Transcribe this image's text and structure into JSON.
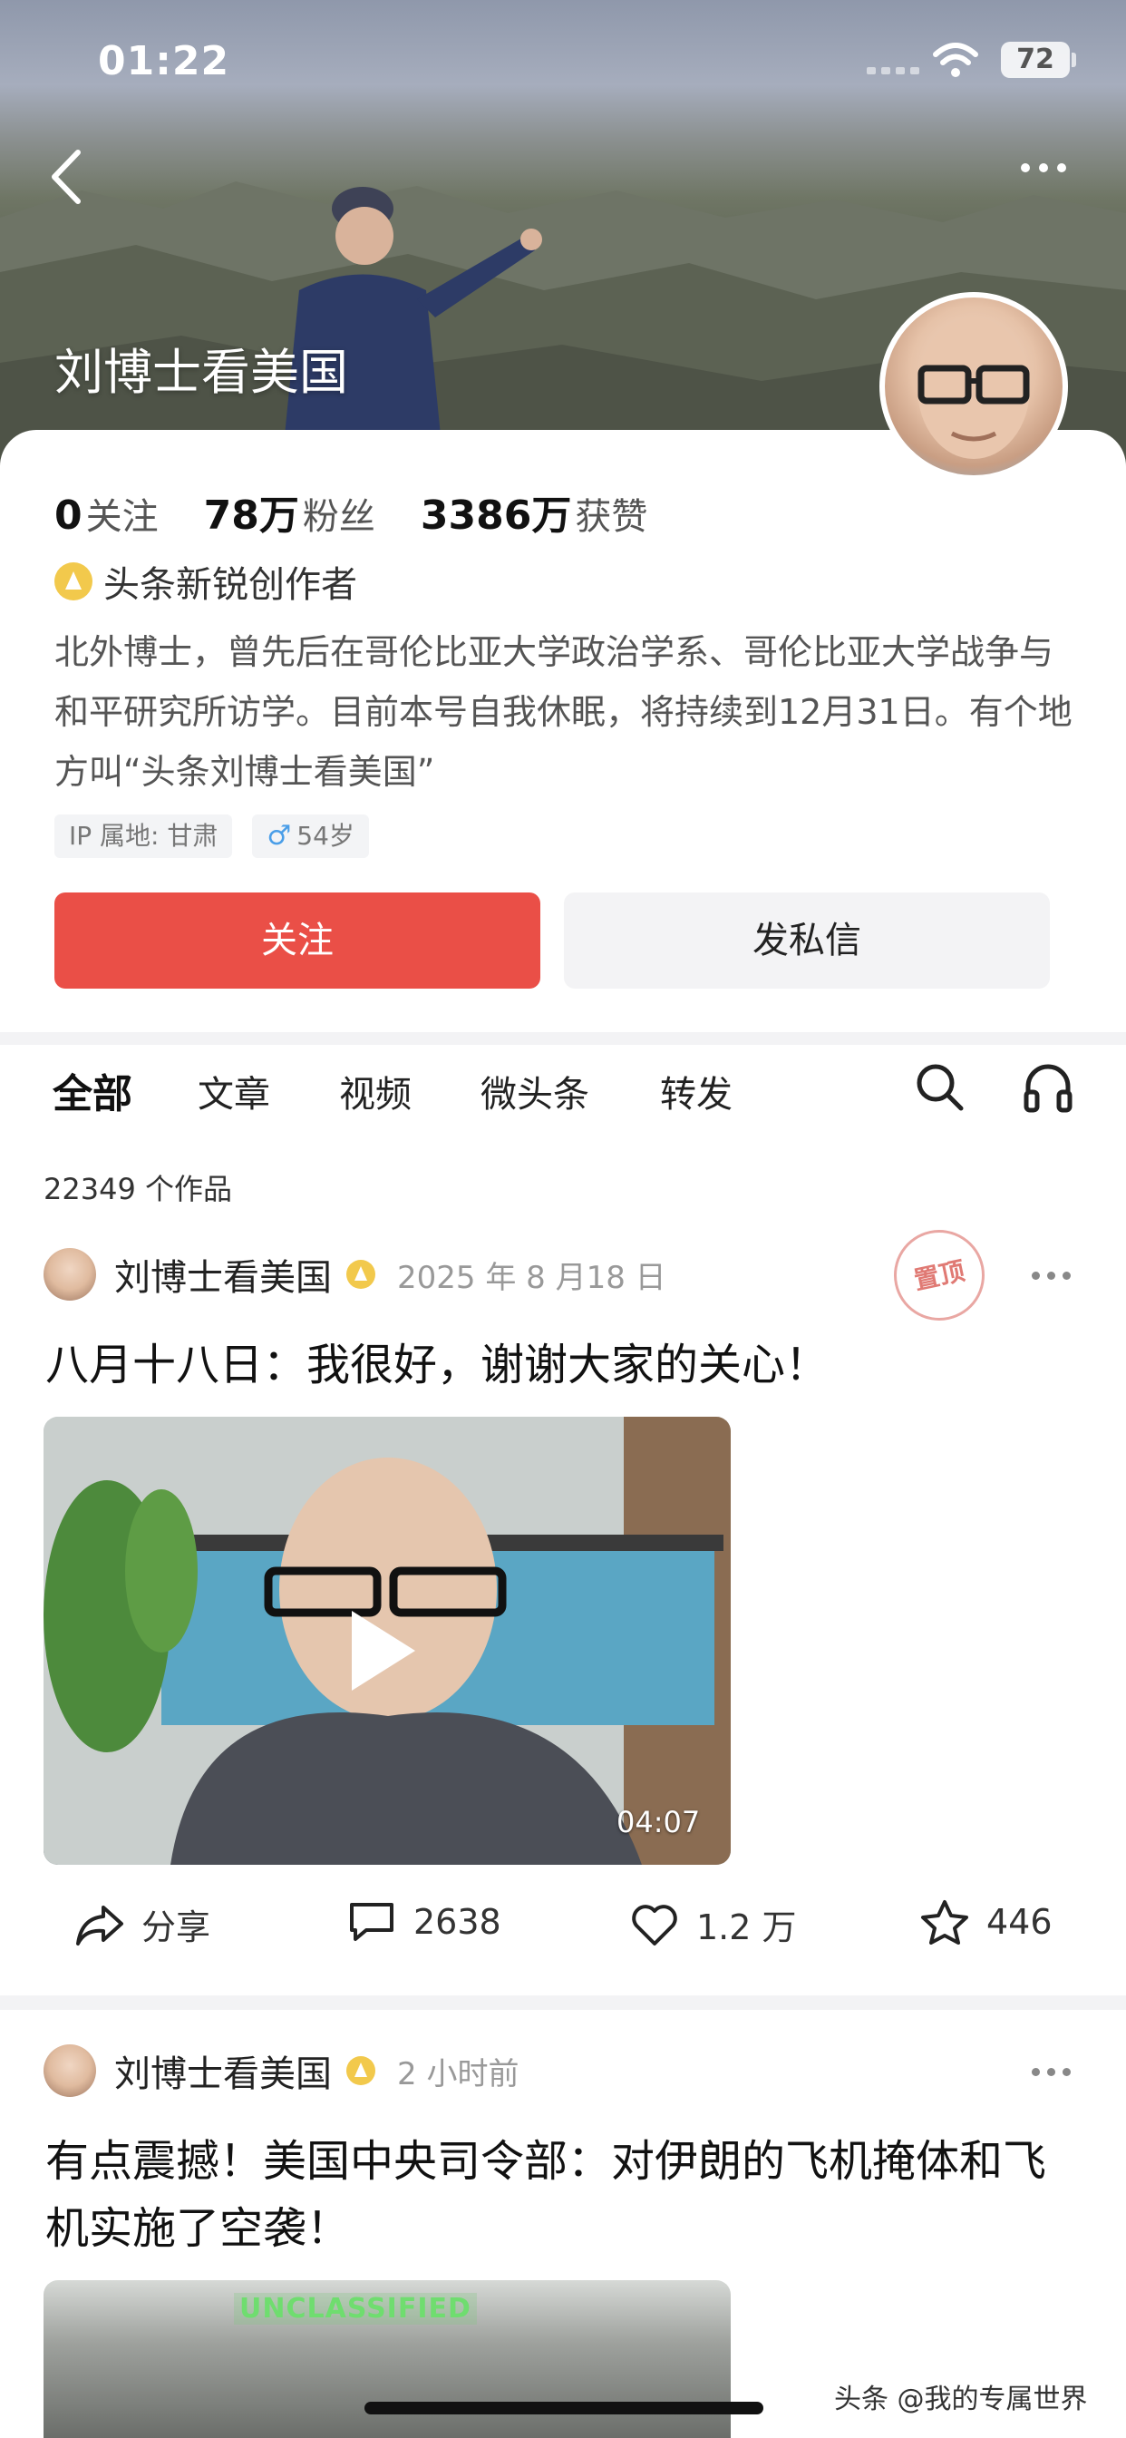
{
  "status_bar": {
    "time": "01:22",
    "battery": "72"
  },
  "profile": {
    "name": "刘博士看美国",
    "stats": [
      {
        "num": "0",
        "label": "关注"
      },
      {
        "num": "78万",
        "label": "粉丝"
      },
      {
        "num": "3386万",
        "label": "获赞"
      }
    ],
    "badge": "头条新锐创作者",
    "bio": "北外博士，曾先后在哥伦比亚大学政治学系、哥伦比亚大学战争与和平研究所访学。目前本号自我休眠，将持续到12月31日。有个地方叫“头条刘博士看美国”",
    "ip_tag": "IP 属地: 甘肃",
    "age_tag": "54岁",
    "follow_label": "关注",
    "message_label": "发私信"
  },
  "tabs": [
    "全部",
    "文章",
    "视频",
    "微头条",
    "转发"
  ],
  "works_count": "22349 个作品",
  "posts": [
    {
      "author": "刘博士看美国",
      "date": "2025 年 8 月18 日",
      "pinned_label": "置顶",
      "title": "八月十八日：我很好，谢谢大家的关心！",
      "duration": "04:07",
      "share_label": "分享",
      "comments": "2638",
      "likes": "1.2 万",
      "favorites": "446"
    },
    {
      "author": "刘博士看美国",
      "date": "2 小时前",
      "title": "有点震撼！美国中央司令部：对伊朗的飞机掩体和飞机实施了空袭！",
      "overlay_text": "UNCLASSIFIED"
    }
  ],
  "watermark": "头条 @我的专属世界",
  "colors": {
    "accent": "#ea4f47",
    "verified": "#f2c94c"
  }
}
